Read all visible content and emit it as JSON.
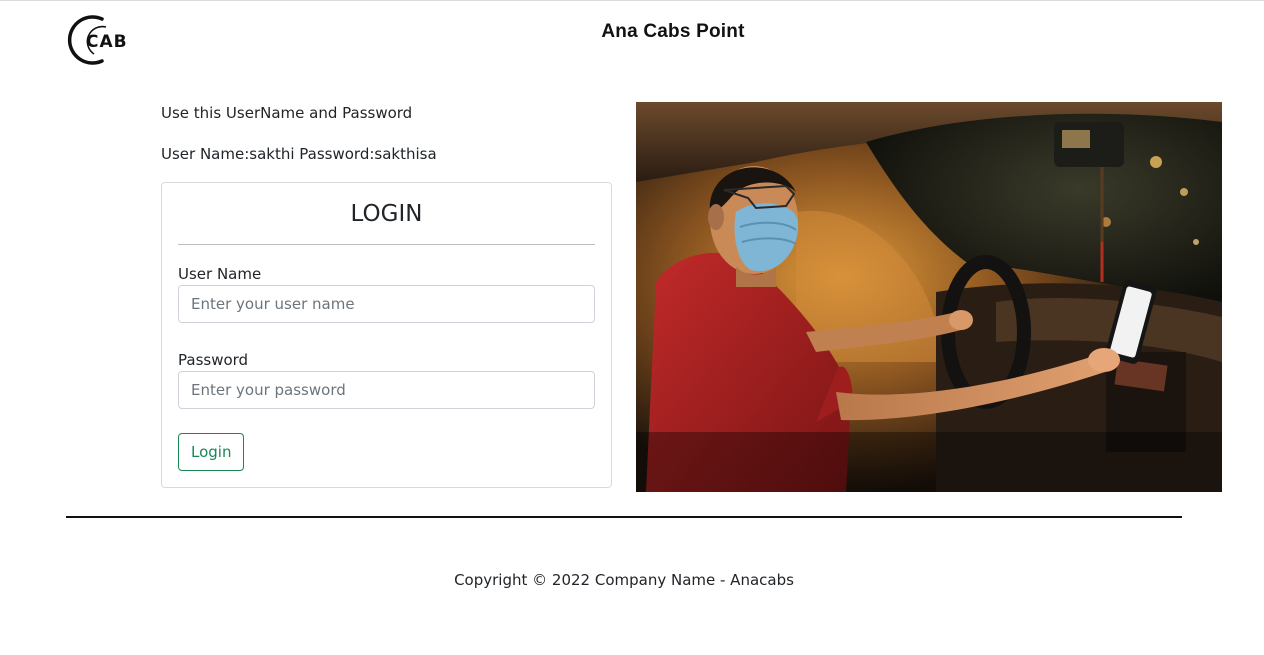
{
  "header": {
    "logo_text": "CAB",
    "title": "Ana Cabs Point"
  },
  "credentials_hint": {
    "line1": "Use this UserName and Password",
    "line2": "User Name:sakthi Password:sakthisa"
  },
  "login_card": {
    "title": "LOGIN",
    "username_label": "User Name",
    "username_placeholder": "Enter your user name",
    "username_value": "",
    "password_label": "Password",
    "password_placeholder": "Enter your password",
    "password_value": "",
    "button_label": "Login"
  },
  "footer": {
    "copyright": "Copyright © 2022 Company Name - Anacabs"
  },
  "colors": {
    "brand_green": "#198754",
    "text": "#212529",
    "border": "#ced4da"
  }
}
